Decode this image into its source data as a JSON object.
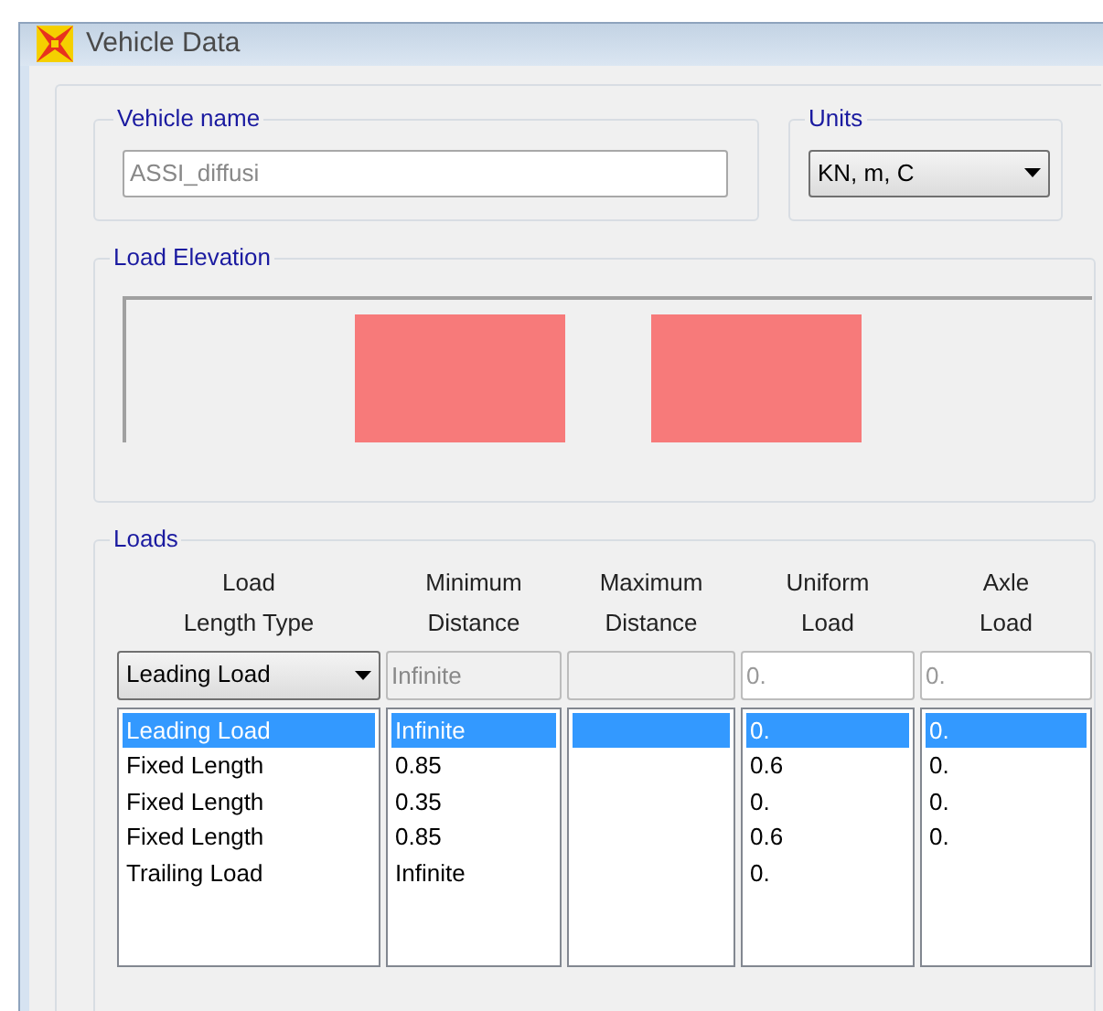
{
  "window": {
    "title": "Vehicle Data"
  },
  "vehicle_name": {
    "label": "Vehicle name",
    "value": "ASSI_diffusi"
  },
  "units": {
    "label": "Units",
    "value": "KN, m, C"
  },
  "load_elevation": {
    "label": "Load Elevation"
  },
  "loads": {
    "label": "Loads",
    "columns": [
      {
        "header": "Load\nLength Type"
      },
      {
        "header": "Minimum\nDistance"
      },
      {
        "header": "Maximum\nDistance"
      },
      {
        "header": "Uniform\nLoad"
      },
      {
        "header": "Axle\nLoad"
      }
    ],
    "editors": [
      {
        "kind": "dropdown",
        "value": "Leading Load",
        "disabled": false
      },
      {
        "kind": "field",
        "value": "Infinite",
        "disabled": true
      },
      {
        "kind": "field",
        "disabled": true
      },
      {
        "kind": "field",
        "placeholder": "0.",
        "disabled": false
      },
      {
        "kind": "field",
        "placeholder": "0.",
        "disabled": false
      }
    ],
    "rows": [
      {
        "load_length_type": "Leading Load",
        "minimum_distance": "Infinite",
        "uniform_load": "0.",
        "axle_load": "0.",
        "selected": true
      },
      {
        "load_length_type": "Fixed Length",
        "minimum_distance": "0.85",
        "uniform_load": "0.6",
        "axle_load": "0.",
        "selected": false
      },
      {
        "load_length_type": "Fixed Length",
        "minimum_distance": "0.35",
        "uniform_load": "0.",
        "axle_load": "0.",
        "selected": false
      },
      {
        "load_length_type": "Fixed Length",
        "minimum_distance": "0.85",
        "uniform_load": "0.6",
        "axle_load": "0.",
        "selected": false
      },
      {
        "load_length_type": "Trailing Load",
        "minimum_distance": "Infinite",
        "uniform_load": "0.",
        "selected": false
      }
    ]
  }
}
